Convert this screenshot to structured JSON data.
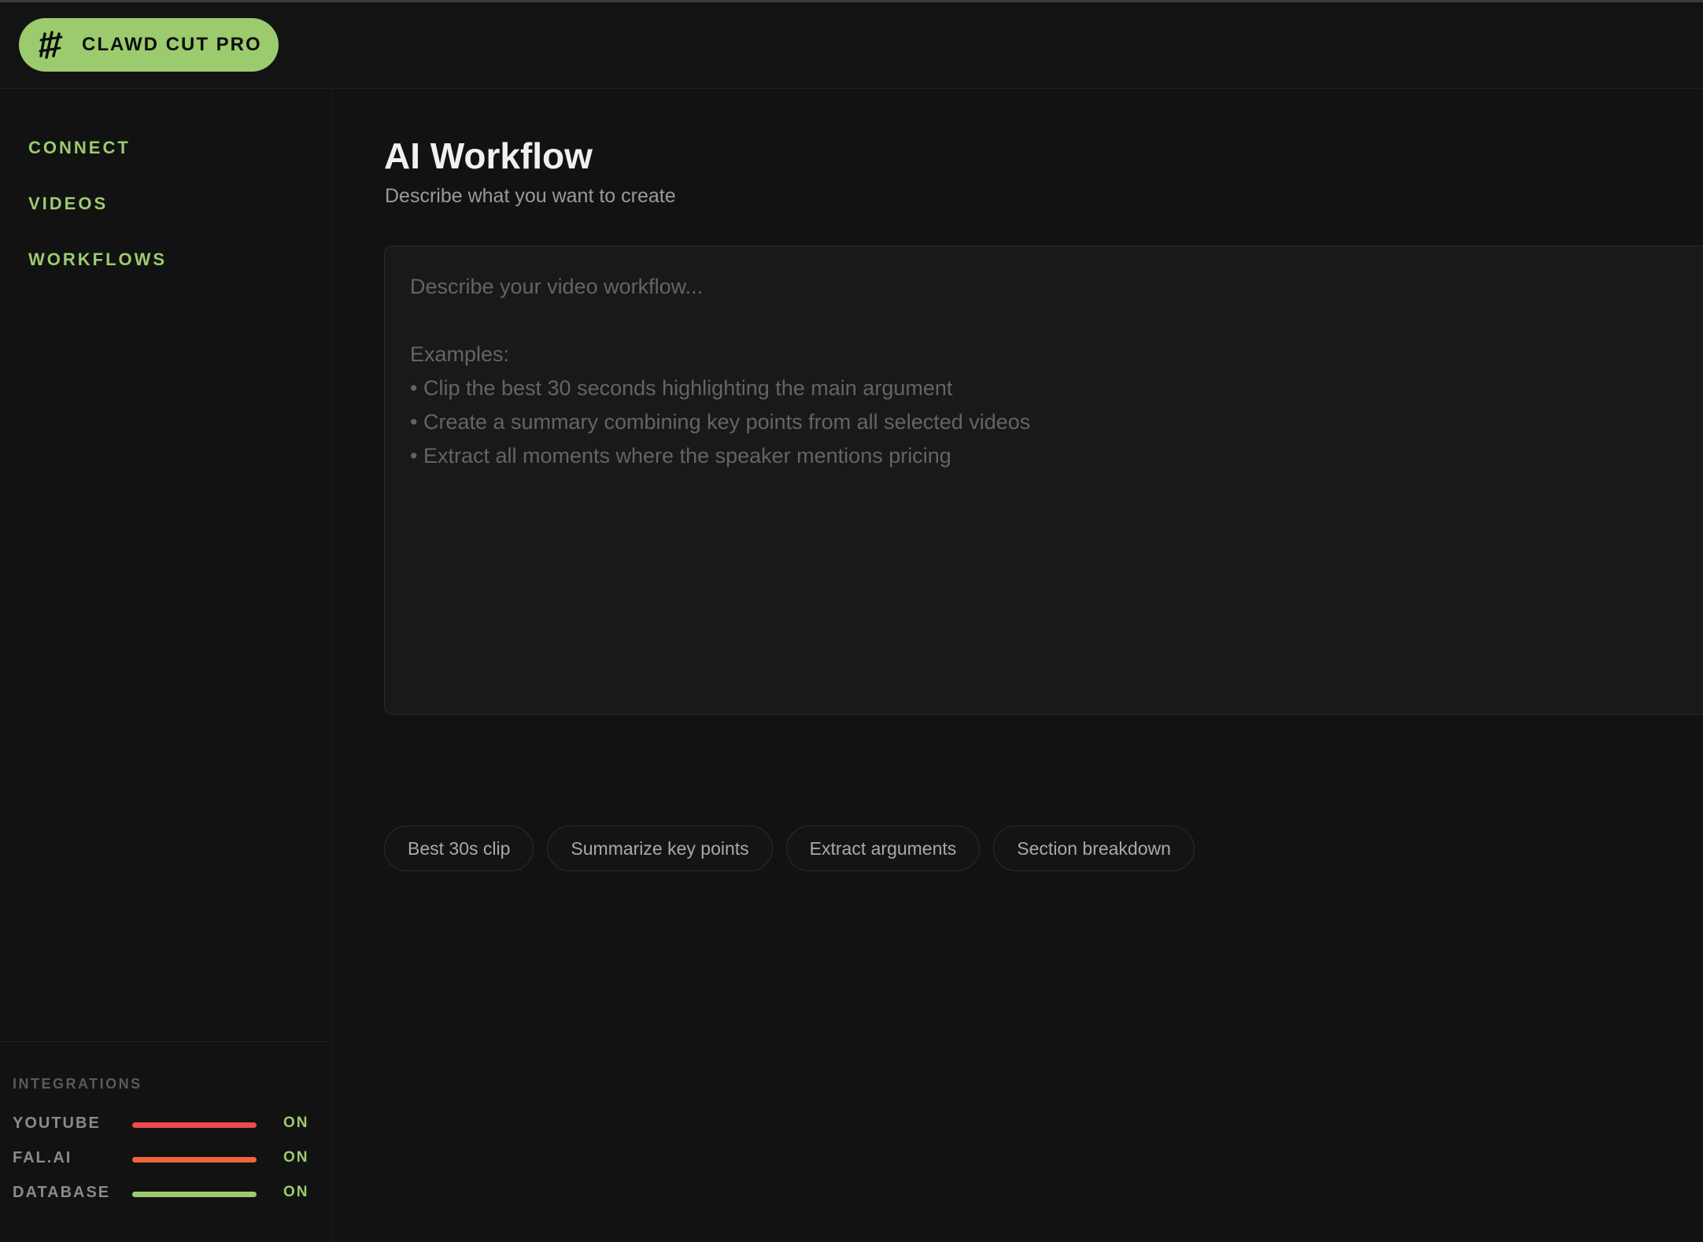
{
  "brand": {
    "label": "CLAWD CUT PRO",
    "icon": "claw-slash-icon"
  },
  "nav": {
    "items": [
      {
        "label": "CONNECT"
      },
      {
        "label": "VIDEOS"
      },
      {
        "label": "WORKFLOWS"
      }
    ]
  },
  "integrations": {
    "title": "INTEGRATIONS",
    "items": [
      {
        "name": "YOUTUBE",
        "status": "ON",
        "color": "#ef4b4b"
      },
      {
        "name": "FAL.AI",
        "status": "ON",
        "color": "#f2643c"
      },
      {
        "name": "DATABASE",
        "status": "ON",
        "color": "#9ccb6e"
      }
    ]
  },
  "main": {
    "title": "AI Workflow",
    "subtitle": "Describe what you want to create",
    "prompt": {
      "value": "",
      "placeholder": "Describe your video workflow...\n\nExamples:\n• Clip the best 30 seconds highlighting the main argument\n• Create a summary combining key points from all selected videos\n• Extract all moments where the speaker mentions pricing"
    },
    "chips": [
      {
        "label": "Best 30s clip"
      },
      {
        "label": "Summarize key points"
      },
      {
        "label": "Extract arguments"
      },
      {
        "label": "Section breakdown"
      }
    ]
  },
  "colors": {
    "accent": "#9ccb6e",
    "background": "#121212",
    "panel": "#191919"
  }
}
